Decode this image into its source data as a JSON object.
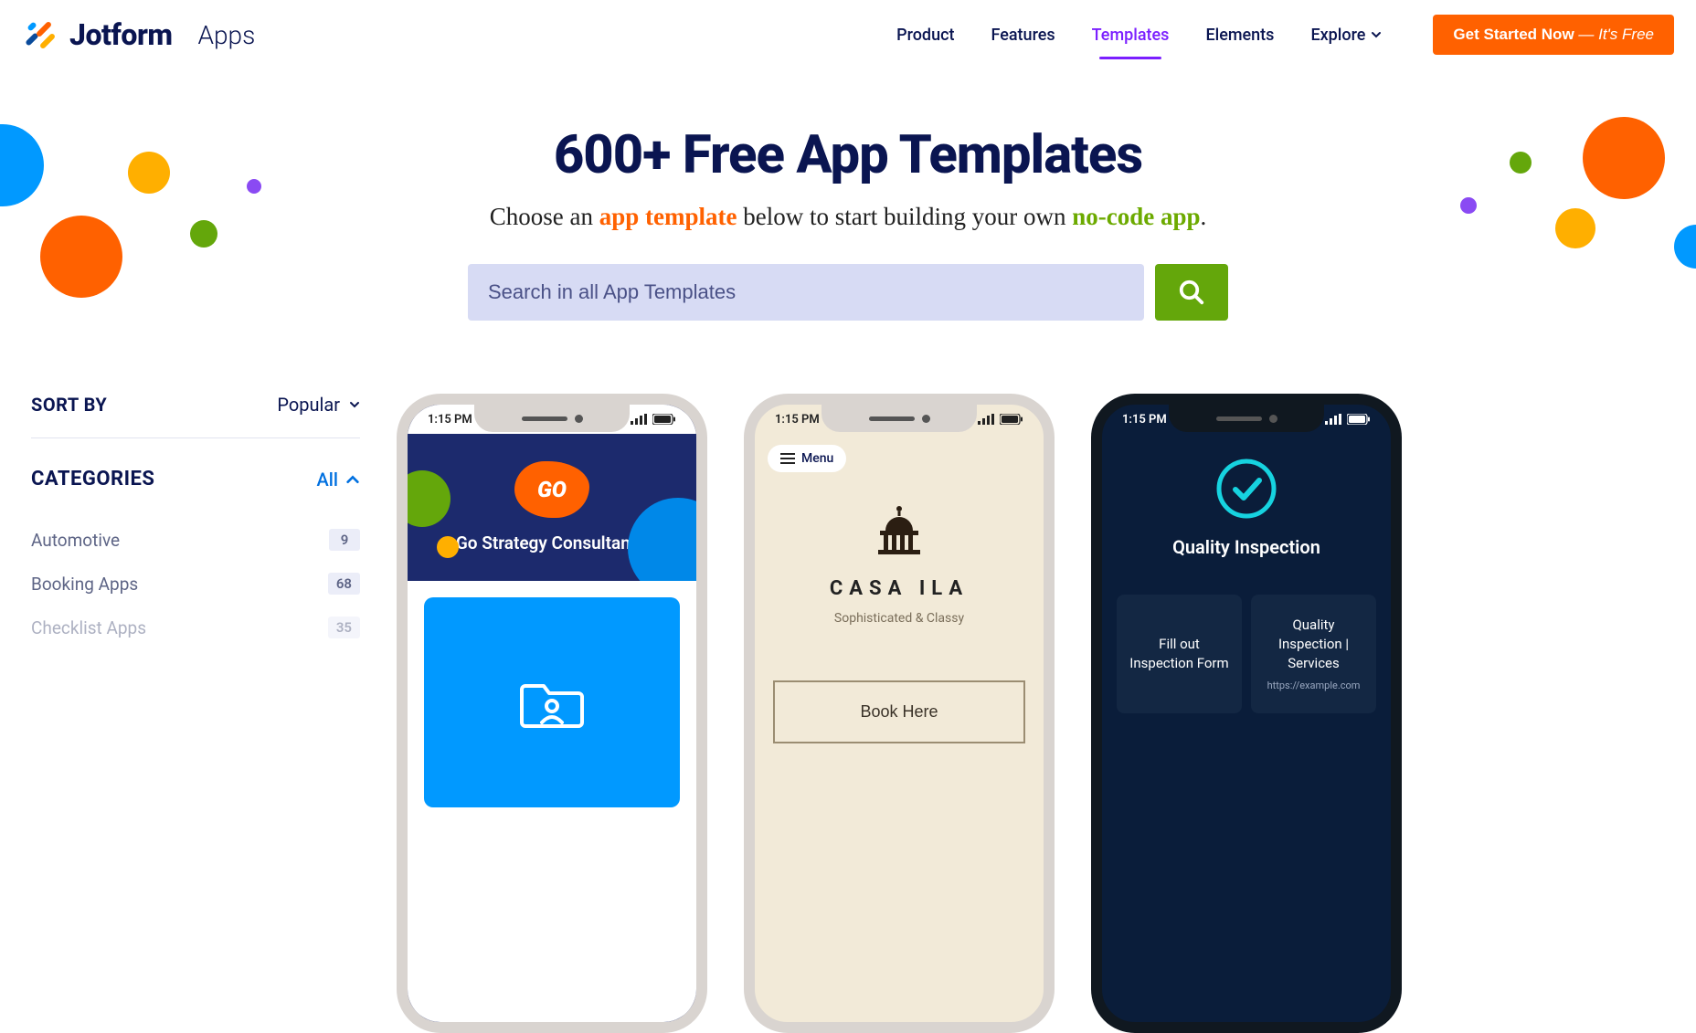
{
  "brand": {
    "name": "Jotform",
    "section": "Apps"
  },
  "nav": {
    "product": "Product",
    "features": "Features",
    "templates": "Templates",
    "elements": "Elements",
    "explore": "Explore"
  },
  "cta": {
    "main": "Get Started Now",
    "em": " — It's Free"
  },
  "hero": {
    "title": "600+ Free App Templates",
    "sub_pre": "Choose an ",
    "sub_orange": "app template",
    "sub_mid": " below to start building your own ",
    "sub_green": "no-code app",
    "sub_post": "."
  },
  "search": {
    "placeholder": "Search in all App Templates"
  },
  "sidebar": {
    "sort_label": "SORT BY",
    "sort_value": "Popular",
    "cat_label": "CATEGORIES",
    "cat_all": "All",
    "items": [
      {
        "name": "Automotive",
        "count": "9"
      },
      {
        "name": "Booking Apps",
        "count": "68"
      },
      {
        "name": "Checklist Apps",
        "count": "35"
      }
    ]
  },
  "templates": {
    "t1": {
      "time": "1:15 PM",
      "title": "Go Strategy Consultancy",
      "logo_text": "GO"
    },
    "t2": {
      "time": "1:15 PM",
      "menu": "Menu",
      "title": "CASA ILA",
      "sub": "Sophisticated & Classy",
      "button": "Book Here"
    },
    "t3": {
      "time": "1:15 PM",
      "title": "Quality Inspection",
      "card1": "Fill out Inspection Form",
      "card2": "Quality Inspection | Services",
      "card2_link": "https://example.com"
    }
  }
}
